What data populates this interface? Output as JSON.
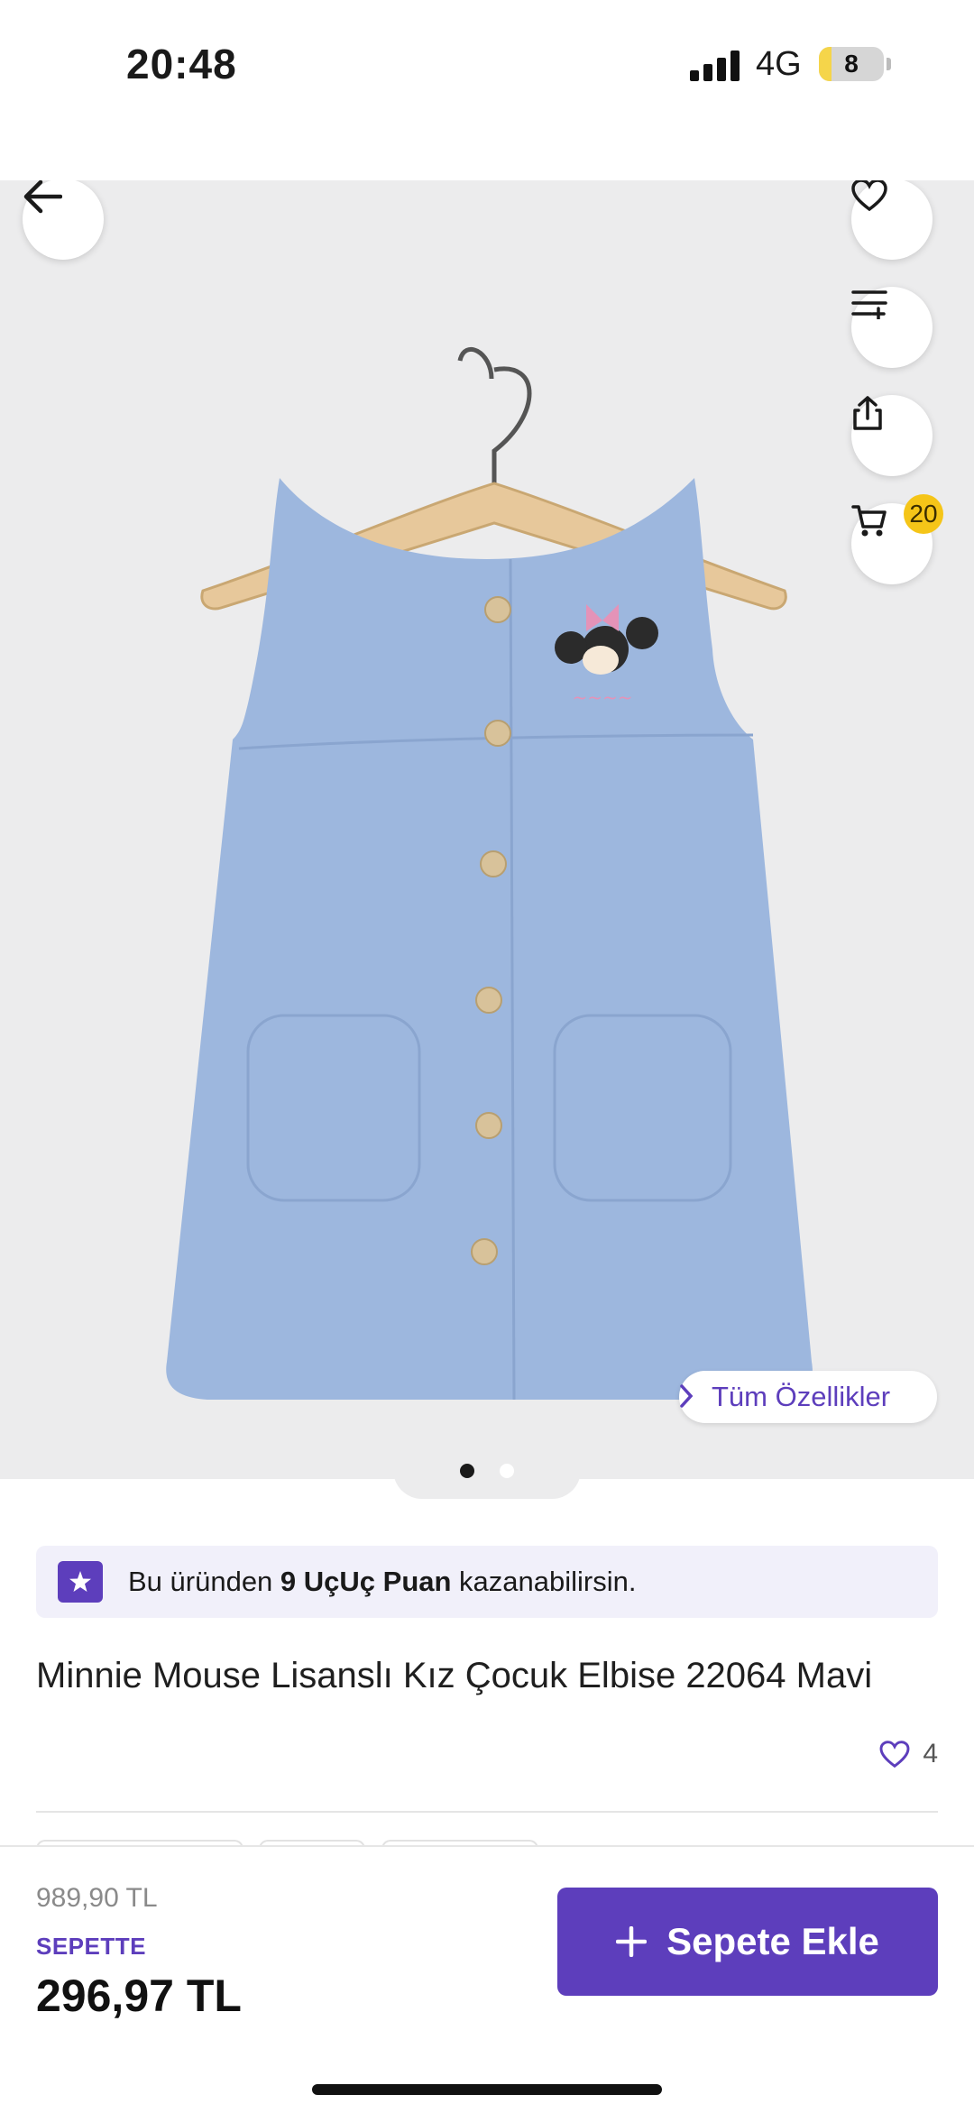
{
  "status_bar": {
    "time": "20:48",
    "network": "4G",
    "battery": "8"
  },
  "product_image": {
    "alt": "Minnie Mouse Lisanslı Kız Çocuk Elbise 22064 Mavi"
  },
  "actions": {
    "back": "back-arrow-icon",
    "favorite": "heart-icon",
    "compare": "list-add-icon",
    "share": "share-icon",
    "cart": "cart-icon",
    "cart_count": "20"
  },
  "all_features_label": "Tüm Özellikler",
  "gallery": {
    "current": 1,
    "total": 2
  },
  "points_banner": {
    "prefix": "Bu üründen ",
    "bold": "9 UçUç Puan",
    "suffix": " kazanabilirsin."
  },
  "product": {
    "title": "Minnie Mouse Lisanslı Kız Çocuk Elbise 22064 Mavi",
    "favorites_count": "4"
  },
  "pricing": {
    "old_price": "989,90 TL",
    "basket_label": "SEPETTE",
    "price": "296,97 TL"
  },
  "add_to_cart_label": "Sepete Ekle",
  "colors": {
    "brand": "#5d3ebc",
    "badge": "#f5c518",
    "dress": "#9db7de"
  }
}
